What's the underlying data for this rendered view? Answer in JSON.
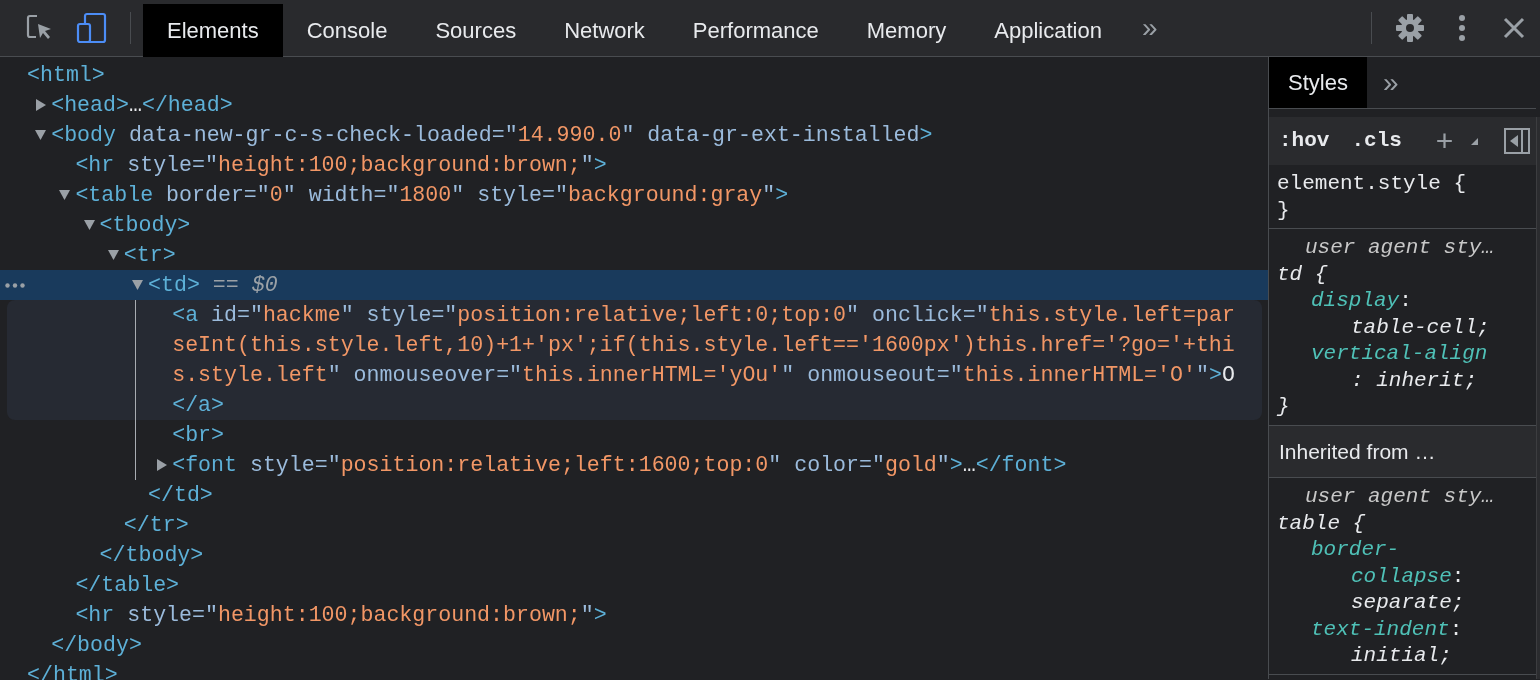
{
  "toolbar": {
    "tools": [
      {
        "kind": "inspect",
        "selected": false
      },
      {
        "kind": "device",
        "selected": true
      }
    ],
    "tabs": [
      {
        "label": "Elements",
        "selected": true
      },
      {
        "label": "Console",
        "selected": false
      },
      {
        "label": "Sources",
        "selected": false
      },
      {
        "label": "Network",
        "selected": false
      },
      {
        "label": "Performance",
        "selected": false
      },
      {
        "label": "Memory",
        "selected": false
      },
      {
        "label": "Application",
        "selected": false
      }
    ],
    "more": "»"
  },
  "dom_tree": {
    "nodes": [
      {
        "lines": [
          [
            {
              "kind": "tag",
              "text": "<html>"
            }
          ]
        ],
        "selected": false,
        "hovered": false,
        "close": [
          {
            "kind": "tag",
            "text": "</html>"
          }
        ],
        "children": [
          {
            "lines": [
              [
                {
                  "kind": "tag",
                  "text": "<head>"
                },
                {
                  "kind": "text",
                  "text": "…"
                },
                {
                  "kind": "tag",
                  "text": "</head>"
                }
              ]
            ],
            "expanded": false,
            "selected": false,
            "hovered": false
          },
          {
            "lines": [
              [
                {
                  "kind": "tag",
                  "text": "<body"
                },
                {
                  "kind": "attr",
                  "text": " data-new-gr-c-s-check-loaded=\""
                },
                {
                  "kind": "value",
                  "text": "14.990.0"
                },
                {
                  "kind": "attr",
                  "text": "\" data-gr-ext-installed"
                },
                {
                  "kind": "tag",
                  "text": ">"
                }
              ]
            ],
            "expanded": true,
            "selected": false,
            "hovered": false,
            "close": [
              {
                "kind": "tag",
                "text": "</body>"
              }
            ],
            "children": [
              {
                "lines": [
                  [
                    {
                      "kind": "tag",
                      "text": "<hr"
                    },
                    {
                      "kind": "attr",
                      "text": " style=\""
                    },
                    {
                      "kind": "value",
                      "text": "height:100;background:brown;"
                    },
                    {
                      "kind": "attr",
                      "text": "\""
                    },
                    {
                      "kind": "tag",
                      "text": ">"
                    }
                  ]
                ],
                "selected": false,
                "hovered": false
              },
              {
                "lines": [
                  [
                    {
                      "kind": "tag",
                      "text": "<table"
                    },
                    {
                      "kind": "attr",
                      "text": " border=\""
                    },
                    {
                      "kind": "value",
                      "text": "0"
                    },
                    {
                      "kind": "attr",
                      "text": "\" width=\""
                    },
                    {
                      "kind": "value",
                      "text": "1800"
                    },
                    {
                      "kind": "attr",
                      "text": "\" style=\""
                    },
                    {
                      "kind": "value",
                      "text": "background:gray"
                    },
                    {
                      "kind": "attr",
                      "text": "\""
                    },
                    {
                      "kind": "tag",
                      "text": ">"
                    }
                  ]
                ],
                "expanded": true,
                "selected": false,
                "hovered": false,
                "close": [
                  {
                    "kind": "tag",
                    "text": "</table>"
                  }
                ],
                "children": [
                  {
                    "lines": [
                      [
                        {
                          "kind": "tag",
                          "text": "<tbody>"
                        }
                      ]
                    ],
                    "expanded": true,
                    "selected": false,
                    "hovered": false,
                    "close": [
                      {
                        "kind": "tag",
                        "text": "</tbody>"
                      }
                    ],
                    "children": [
                      {
                        "lines": [
                          [
                            {
                              "kind": "tag",
                              "text": "<tr>"
                            }
                          ]
                        ],
                        "expanded": true,
                        "selected": false,
                        "hovered": false,
                        "close": [
                          {
                            "kind": "tag",
                            "text": "</tr>"
                          }
                        ],
                        "children": [
                          {
                            "lines": [
                              [
                                {
                                  "kind": "tag",
                                  "text": "<td>"
                                },
                                {
                                  "kind": "dim",
                                  "text": " == "
                                },
                                {
                                  "kind": "ref",
                                  "text": "$0"
                                }
                              ]
                            ],
                            "expanded": true,
                            "selected": true,
                            "hovered": false,
                            "close": [
                              {
                                "kind": "tag",
                                "text": "</td>"
                              }
                            ],
                            "children": [
                              {
                                "lines": [
                                  [
                                    {
                                      "kind": "tag",
                                      "text": "<a"
                                    },
                                    {
                                      "kind": "attr",
                                      "text": " id=\""
                                    },
                                    {
                                      "kind": "value",
                                      "text": "hackme"
                                    },
                                    {
                                      "kind": "attr",
                                      "text": "\" style=\""
                                    },
                                    {
                                      "kind": "value",
                                      "text": "position:relative;left:0;top:0"
                                    },
                                    {
                                      "kind": "attr",
                                      "text": "\" onclick=\""
                                    },
                                    {
                                      "kind": "value",
                                      "text": "this.style.left=par"
                                    }
                                  ],
                                  [
                                    {
                                      "kind": "value",
                                      "text": "seInt(this.style.left,10)+1+'px';if(this.style.left=='1600px')this.href='?go='+thi"
                                    }
                                  ],
                                  [
                                    {
                                      "kind": "value",
                                      "text": "s.style.left"
                                    },
                                    {
                                      "kind": "attr",
                                      "text": "\" onmouseover=\""
                                    },
                                    {
                                      "kind": "value",
                                      "text": "this.innerHTML='yOu'"
                                    },
                                    {
                                      "kind": "attr",
                                      "text": "\" onmouseout=\""
                                    },
                                    {
                                      "kind": "value",
                                      "text": "this.innerHTML='O'"
                                    },
                                    {
                                      "kind": "attr",
                                      "text": "\""
                                    },
                                    {
                                      "kind": "tag",
                                      "text": ">"
                                    },
                                    {
                                      "kind": "text",
                                      "text": "O"
                                    }
                                  ],
                                  [
                                    {
                                      "kind": "tag",
                                      "text": "</a>"
                                    }
                                  ]
                                ],
                                "selected": false,
                                "hovered": true
                              },
                              {
                                "lines": [
                                  [
                                    {
                                      "kind": "tag",
                                      "text": "<br>"
                                    }
                                  ]
                                ],
                                "selected": false,
                                "hovered": false
                              },
                              {
                                "lines": [
                                  [
                                    {
                                      "kind": "tag",
                                      "text": "<font"
                                    },
                                    {
                                      "kind": "attr",
                                      "text": " style=\""
                                    },
                                    {
                                      "kind": "value",
                                      "text": "position:relative;left:1600;top:0"
                                    },
                                    {
                                      "kind": "attr",
                                      "text": "\" color=\""
                                    },
                                    {
                                      "kind": "value",
                                      "text": "gold"
                                    },
                                    {
                                      "kind": "attr",
                                      "text": "\""
                                    },
                                    {
                                      "kind": "tag",
                                      "text": ">"
                                    },
                                    {
                                      "kind": "text",
                                      "text": "…"
                                    },
                                    {
                                      "kind": "tag",
                                      "text": "</font>"
                                    }
                                  ]
                                ],
                                "expanded": false,
                                "selected": false,
                                "hovered": false
                              }
                            ]
                          }
                        ]
                      }
                    ]
                  }
                ]
              },
              {
                "lines": [
                  [
                    {
                      "kind": "tag",
                      "text": "<hr"
                    },
                    {
                      "kind": "attr",
                      "text": " style=\""
                    },
                    {
                      "kind": "value",
                      "text": "height:100;background:brown;"
                    },
                    {
                      "kind": "attr",
                      "text": "\""
                    },
                    {
                      "kind": "tag",
                      "text": ">"
                    }
                  ]
                ],
                "selected": false,
                "hovered": false
              }
            ]
          }
        ]
      }
    ]
  },
  "styles_pane": {
    "tabs": [
      {
        "label": "Styles",
        "selected": true
      }
    ],
    "more": "»",
    "filter_buttons": [
      ":hov",
      ".cls"
    ],
    "add": "+",
    "sections": [
      {
        "kind": "rule",
        "lines": [
          [
            {
              "kind": "sel",
              "text": "element.style {"
            }
          ],
          [
            {
              "kind": "sel",
              "text": "}"
            }
          ]
        ]
      },
      {
        "kind": "rule",
        "lines": [
          [
            {
              "kind": "origin",
              "text": "user agent sty…"
            }
          ],
          [
            {
              "kind": "selitalic",
              "text": "td {"
            }
          ],
          [
            {
              "kind": "prop",
              "text": "display"
            },
            {
              "kind": "punct",
              "text": ":"
            }
          ],
          [
            {
              "kind": "pval",
              "text": "table-cell;"
            }
          ],
          [
            {
              "kind": "prop",
              "text": "vertical-align"
            }
          ],
          [
            {
              "kind": "pval",
              "text": ": inherit;"
            }
          ],
          [
            {
              "kind": "selitalic",
              "text": "}"
            }
          ]
        ]
      },
      {
        "kind": "header",
        "text": "Inherited from …"
      },
      {
        "kind": "rule",
        "lines": [
          [
            {
              "kind": "origin",
              "text": "user agent sty…"
            }
          ],
          [
            {
              "kind": "selitalic",
              "text": "table {"
            }
          ],
          [
            {
              "kind": "prop",
              "text": "border-"
            }
          ],
          [
            {
              "kind": "prop2",
              "text": "collapse"
            },
            {
              "kind": "punct",
              "text": ":"
            }
          ],
          [
            {
              "kind": "pval",
              "text": "separate;"
            }
          ],
          [
            {
              "kind": "prop",
              "text": "text-indent"
            },
            {
              "kind": "punct",
              "text": ":"
            }
          ],
          [
            {
              "kind": "pval",
              "text": "initial;"
            }
          ]
        ]
      }
    ]
  }
}
